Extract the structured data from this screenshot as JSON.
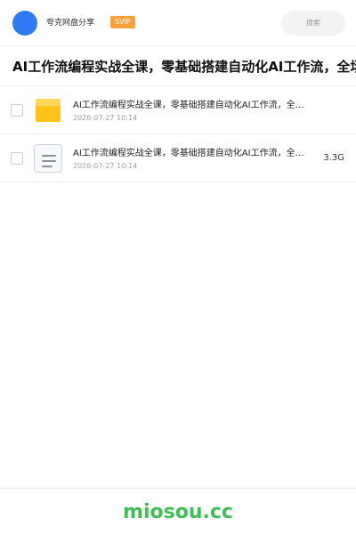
{
  "header": {
    "username": "夸克网盘分享",
    "badge": "SVIP",
    "search_placeholder": "搜索"
  },
  "share_title": "AI工作流编程实战全课，零基础搭建自动化AI工作流，全场景落地实践",
  "files": [
    {
      "name": "AI工作流编程实战全课，零基础搭建自动化AI工作流，全场景落地实践",
      "date": "2026-07-27 10:14",
      "size": "",
      "type": "folder"
    },
    {
      "name": "AI工作流编程实战全课，零基础搭建自动化AI工作流，全场景落地实践",
      "date": "2026-07-27 10:14",
      "size": "3.3G",
      "type": "document"
    }
  ],
  "footer": {
    "brand": "miosou.cc"
  },
  "colors": {
    "avatar": "#2f7bf6",
    "svip_badge": "#f6a13a",
    "folder": "#ffc21a",
    "brand": "#3fbf55"
  },
  "icons": {
    "folder": "folder-icon",
    "document": "document-icon"
  }
}
